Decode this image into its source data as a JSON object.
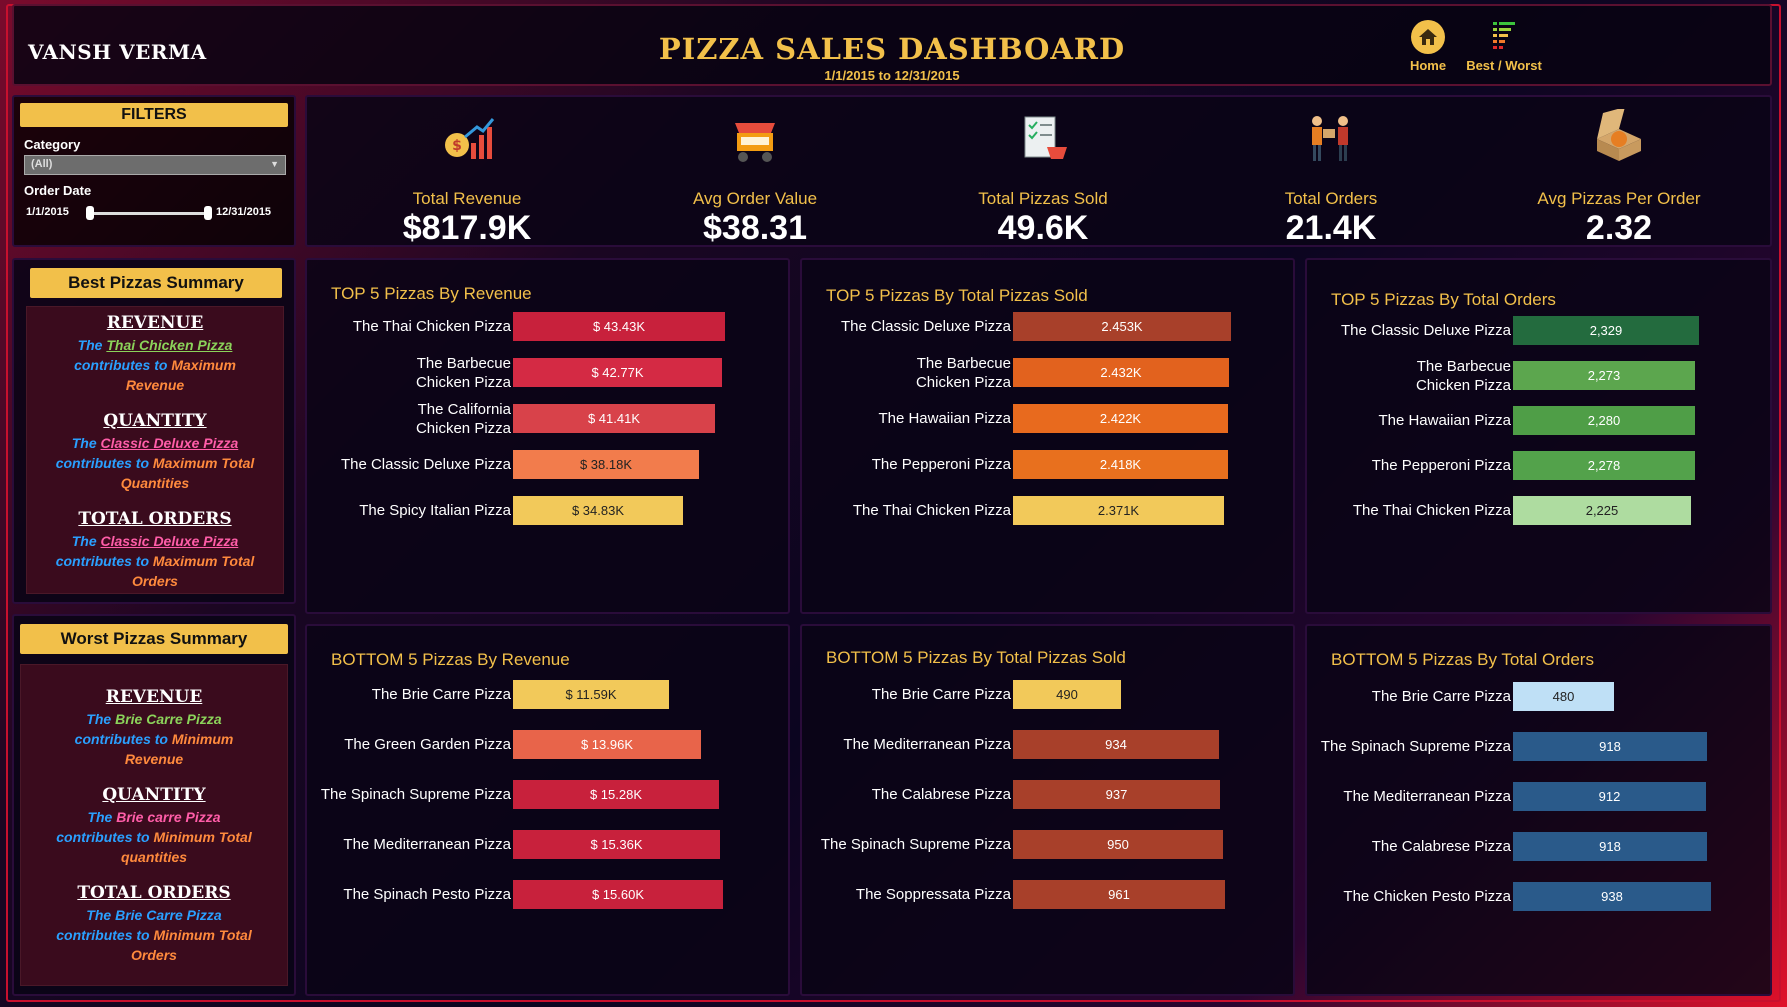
{
  "header": {
    "author": "VANSH VERMA",
    "title": "PIZZA SALES DASHBOARD",
    "date_range": "1/1/2015 to 12/31/2015",
    "nav": {
      "home": "Home",
      "best_worst": "Best / Worst"
    }
  },
  "filters": {
    "title": "FILTERS",
    "category_label": "Category",
    "category_value": "(All)",
    "order_date_label": "Order Date",
    "date_start": "1/1/2015",
    "date_end": "12/31/2015"
  },
  "kpis": [
    {
      "label": "Total Revenue",
      "value": "$817.9K",
      "icon": "money-chart-icon"
    },
    {
      "label": "Avg Order Value",
      "value": "$38.31",
      "icon": "food-cart-icon"
    },
    {
      "label": "Total Pizzas Sold",
      "value": "49.6K",
      "icon": "checklist-cart-icon"
    },
    {
      "label": "Total Orders",
      "value": "21.4K",
      "icon": "delivery-people-icon"
    },
    {
      "label": "Avg Pizzas Per Order",
      "value": "2.32",
      "icon": "pizza-box-icon"
    }
  ],
  "best_summary": {
    "title": "Best Pizzas Summary",
    "revenue": {
      "heading": "REVENUE",
      "the": "The",
      "pizza": "Thai Chicken Pizza",
      "line2": "contributes to",
      "line2b": "Maximum",
      "line3": "Revenue"
    },
    "quantity": {
      "heading": "QUANTITY",
      "the": "The",
      "pizza": "Classic Deluxe Pizza",
      "line2": "contributes to",
      "line2b": "Maximum Total",
      "line3": "Quantities"
    },
    "orders": {
      "heading": "TOTAL ORDERS",
      "the": "The",
      "pizza": "Classic Deluxe Pizza",
      "line2": "contributes to",
      "line2b": "Maximum Total",
      "line3": "Orders"
    }
  },
  "worst_summary": {
    "title": "Worst Pizzas Summary",
    "revenue": {
      "heading": "REVENUE",
      "the": "The",
      "pizza": "Brie Carre Pizza",
      "line2": "contributes to",
      "line2b": "Minimum",
      "line3": "Revenue"
    },
    "quantity": {
      "heading": "QUANTITY",
      "the": "The",
      "pizza": "Brie carre Pizza",
      "line2": "contributes to",
      "line2b": "Minimum Total",
      "line3": "quantities"
    },
    "orders": {
      "heading": "TOTAL ORDERS",
      "the": "The",
      "pizza": "Brie Carre Pizza",
      "line2": "contributes to",
      "line2b": "Minimum Total",
      "line3": "Orders"
    }
  },
  "chart_data": [
    {
      "type": "bar",
      "title": "TOP 5 Pizzas By Revenue",
      "categories": [
        "The Thai Chicken Pizza",
        "The Barbecue Chicken Pizza",
        "The California Chicken Pizza",
        "The Classic Deluxe Pizza",
        "The Spicy Italian Pizza"
      ],
      "values": [
        43.43,
        42.77,
        41.41,
        38.18,
        34.83
      ],
      "labels": [
        "$ 43.43K",
        "$ 42.77K",
        "$ 41.41K",
        "$ 38.18K",
        "$ 34.83K"
      ],
      "colors": [
        "#c8213c",
        "#d42a44",
        "#d8424a",
        "#f27c4c",
        "#f2c95a"
      ],
      "label_colors": [
        "#fff",
        "#fff",
        "#fff",
        "#222",
        "#222"
      ],
      "xlim": [
        0,
        43.43
      ]
    },
    {
      "type": "bar",
      "title": "TOP 5 Pizzas By Total Pizzas Sold",
      "categories": [
        "The Classic Deluxe Pizza",
        "The Barbecue Chicken Pizza",
        "The Hawaiian Pizza",
        "The Pepperoni Pizza",
        "The Thai Chicken Pizza"
      ],
      "values": [
        2.453,
        2.432,
        2.422,
        2.418,
        2.371
      ],
      "labels": [
        "2.453K",
        "2.432K",
        "2.422K",
        "2.418K",
        "2.371K"
      ],
      "colors": [
        "#a8402a",
        "#e2621e",
        "#e86a1e",
        "#e8701e",
        "#f2c95a"
      ],
      "label_colors": [
        "#fff",
        "#fff",
        "#fff",
        "#fff",
        "#222"
      ],
      "xlim": [
        0,
        2.453
      ]
    },
    {
      "type": "bar",
      "title": "TOP 5 Pizzas By Total Orders",
      "categories": [
        "The Classic Deluxe Pizza",
        "The Barbecue Chicken Pizza",
        "The Hawaiian Pizza",
        "The Pepperoni Pizza",
        "The Thai Chicken Pizza"
      ],
      "values": [
        2329,
        2273,
        2280,
        2278,
        2225
      ],
      "labels": [
        "2,329",
        "2,273",
        "2,280",
        "2,278",
        "2,225"
      ],
      "colors": [
        "#236b3e",
        "#5ca64e",
        "#4f9e47",
        "#53a24b",
        "#aedca0"
      ],
      "label_colors": [
        "#fff",
        "#fff",
        "#fff",
        "#fff",
        "#222"
      ],
      "xlim": [
        0,
        2329
      ]
    },
    {
      "type": "bar",
      "title": "BOTTOM 5 Pizzas By Revenue",
      "categories": [
        "The Brie Carre Pizza",
        "The Green Garden Pizza",
        "The Spinach Supreme Pizza",
        "The Mediterranean Pizza",
        "The Spinach Pesto Pizza"
      ],
      "values": [
        11.59,
        13.96,
        15.28,
        15.36,
        15.6
      ],
      "labels": [
        "$ 11.59K",
        "$ 13.96K",
        "$ 15.28K",
        "$ 15.36K",
        "$ 15.60K"
      ],
      "colors": [
        "#f2c95a",
        "#e8644a",
        "#c8213c",
        "#c8213c",
        "#c8213c"
      ],
      "label_colors": [
        "#222",
        "#fff",
        "#fff",
        "#fff",
        "#fff"
      ],
      "xlim": [
        0,
        15.6
      ]
    },
    {
      "type": "bar",
      "title": "BOTTOM 5 Pizzas By Total Pizzas Sold",
      "categories": [
        "The Brie Carre Pizza",
        "The Mediterranean Pizza",
        "The Calabrese Pizza",
        "The Spinach Supreme Pizza",
        "The Soppressata Pizza"
      ],
      "values": [
        490,
        934,
        937,
        950,
        961
      ],
      "labels": [
        "490",
        "934",
        "937",
        "950",
        "961"
      ],
      "colors": [
        "#f2c95a",
        "#a8402a",
        "#a8402a",
        "#a8402a",
        "#a8402a"
      ],
      "label_colors": [
        "#222",
        "#fff",
        "#fff",
        "#fff",
        "#fff"
      ],
      "xlim": [
        0,
        961
      ]
    },
    {
      "type": "bar",
      "title": "BOTTOM 5 Pizzas By Total Orders",
      "categories": [
        "The Brie Carre Pizza",
        "The Spinach Supreme Pizza",
        "The Mediterranean Pizza",
        "The Calabrese Pizza",
        "The Chicken Pesto Pizza"
      ],
      "values": [
        480,
        918,
        912,
        918,
        938
      ],
      "labels": [
        "480",
        "918",
        "912",
        "918",
        "938"
      ],
      "colors": [
        "#bfe0f6",
        "#2a5a8a",
        "#2a5a8a",
        "#2a5a8a",
        "#2a5a8a"
      ],
      "label_colors": [
        "#222",
        "#fff",
        "#fff",
        "#fff",
        "#fff"
      ],
      "xlim": [
        0,
        938
      ]
    }
  ]
}
